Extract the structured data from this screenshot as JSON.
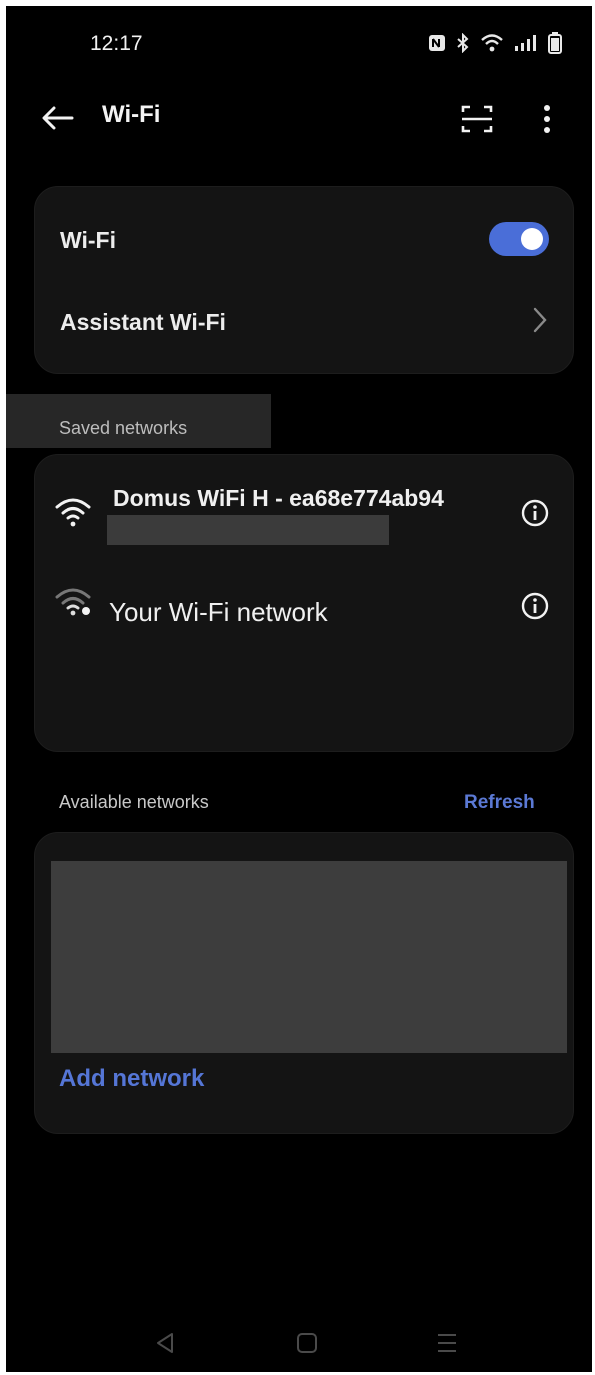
{
  "status_bar": {
    "time": "12:17",
    "icons": [
      "nfc-icon",
      "bluetooth-icon",
      "wifi-icon",
      "signal-icon",
      "battery-icon"
    ]
  },
  "app_bar": {
    "title": "Wi-Fi",
    "icons": [
      "back-arrow-icon",
      "scan-qr-icon",
      "more-vert-icon"
    ]
  },
  "wifi_card": {
    "wifi_label": "Wi-Fi",
    "wifi_enabled": true,
    "assistant_label": "Assistant Wi-Fi"
  },
  "saved": {
    "header": "Saved networks",
    "networks": [
      {
        "name": "Domus WiFi H - ea68e774ab94",
        "icon": "wifi-full-icon"
      },
      {
        "name": "Your Wi-Fi network",
        "icon": "wifi-weak-icon"
      }
    ]
  },
  "available": {
    "header": "Available networks",
    "refresh_label": "Refresh",
    "add_network_label": "Add network"
  },
  "nav": {
    "icons": [
      "nav-back-icon",
      "nav-home-icon",
      "nav-recents-icon"
    ]
  },
  "colors": {
    "accent": "#4a6ed8",
    "link": "#5576d6",
    "card": "#141414",
    "background": "#000000"
  }
}
